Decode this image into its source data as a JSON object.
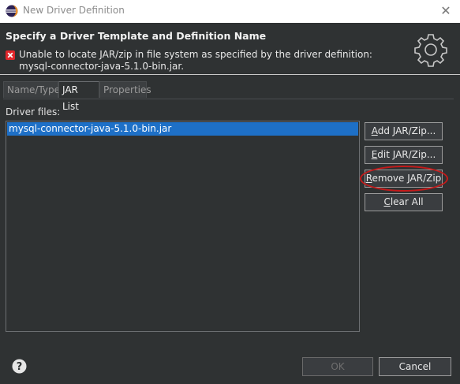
{
  "window": {
    "title": "New Driver Definition"
  },
  "header": {
    "heading": "Specify a Driver Template and Definition Name",
    "error_line1": "Unable to locate JAR/zip in file system as specified by the driver definition:",
    "error_line2": "mysql-connector-java-5.1.0-bin.jar."
  },
  "tabs": [
    {
      "label": "Name/Type"
    },
    {
      "label": "JAR List"
    },
    {
      "label": "Properties"
    }
  ],
  "driver_files": {
    "label": "Driver files:",
    "items": [
      "mysql-connector-java-5.1.0-bin.jar"
    ]
  },
  "buttons": {
    "add": {
      "mnemonic": "A",
      "rest": "dd JAR/Zip..."
    },
    "edit": {
      "mnemonic": "E",
      "rest": "dit JAR/Zip..."
    },
    "remove": {
      "mnemonic": "R",
      "rest": "emove JAR/Zip"
    },
    "clear": {
      "mnemonic": "C",
      "rest": "lear All"
    }
  },
  "footer": {
    "ok": "OK",
    "cancel": "Cancel"
  },
  "colors": {
    "selection": "#1e70c7",
    "error": "#e0262b",
    "highlight": "#c41a1a"
  }
}
